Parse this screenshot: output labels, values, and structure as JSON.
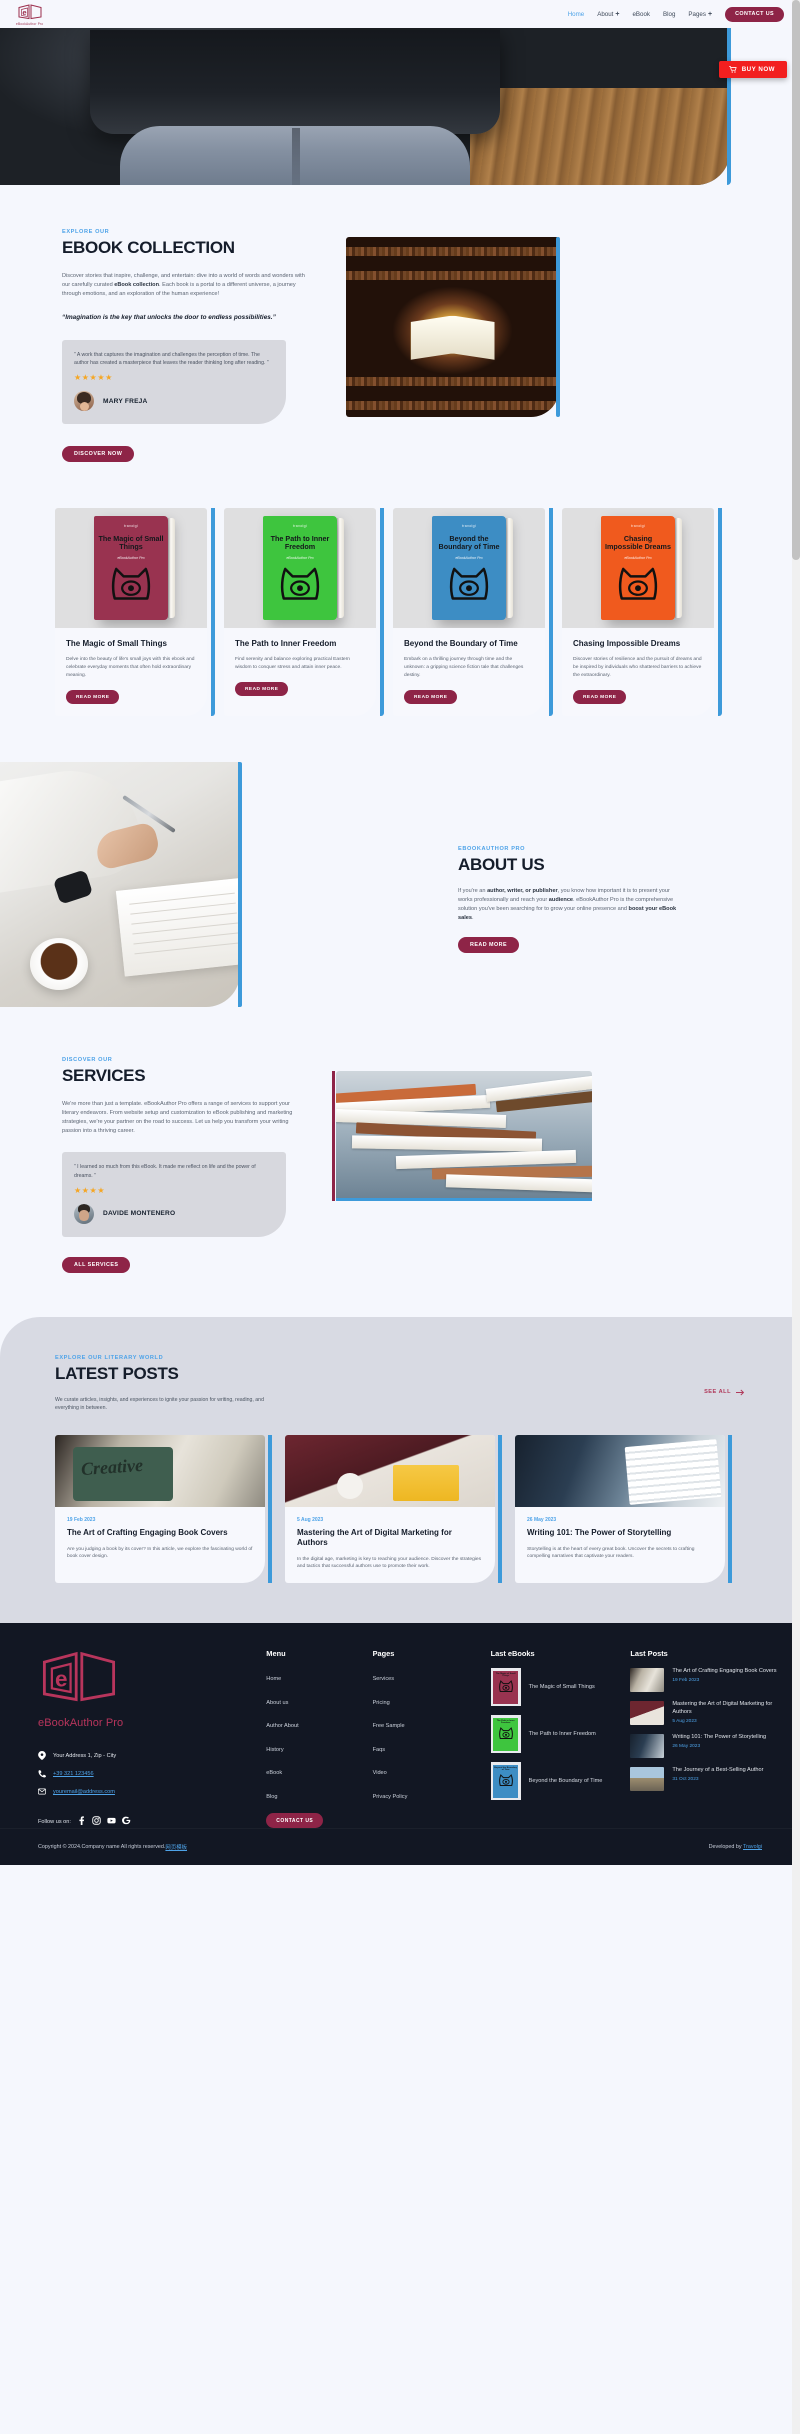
{
  "brand": {
    "name": "eBookAuthor Pro",
    "logo_icon": "open-book-e-logo"
  },
  "nav": {
    "items": [
      {
        "label": "Home",
        "active": true,
        "caret": false
      },
      {
        "label": "About",
        "active": false,
        "caret": true
      },
      {
        "label": "eBook",
        "active": false,
        "caret": false
      },
      {
        "label": "Blog",
        "active": false,
        "caret": false
      },
      {
        "label": "Pages",
        "active": false,
        "caret": true
      }
    ],
    "cta": "CONTACT US"
  },
  "hero": {
    "buy_label": "BUY NOW",
    "cart_icon": "shopping-cart-icon"
  },
  "collection": {
    "eyebrow": "EXPLORE OUR",
    "title": "EBOOK COLLECTION",
    "paragraph_1": "Discover stories that inspire, challenge, and entertain: dive into a world of words and wonders with our carefully curated ",
    "paragraph_bold": "eBook collection",
    "paragraph_2": ". Each book is a portal to a different universe, a journey through emotions, and an exploration of the human experience!",
    "quote": "“Imagination is the key that unlocks the door to endless possibilities.”",
    "testimonial": {
      "text": "” A work that captures the imagination and challenges the perception of time. The author has created a masterpiece that leaves the reader thinking long after reading. ”",
      "stars": "★★★★★",
      "name": "MARY FREJA"
    },
    "button": "DISCOVER NOW"
  },
  "books": [
    {
      "cover_title": "The Magic of Small Things",
      "cover_sub": "eBookAuthor Pro",
      "cover_logo": "travolgi",
      "color": "#993350",
      "title": "The Magic of Small Things",
      "desc": "Delve into the beauty of life's small joys with this ebook and celebrate everyday moments that often hold extraordinary meaning.",
      "button": "READ MORE"
    },
    {
      "cover_title": "The Path to Inner Freedom",
      "cover_sub": "eBookAuthor Pro",
      "cover_logo": "travolgi",
      "color": "#3ec53e",
      "title": "The Path to Inner Freedom",
      "desc": "Find serenity and balance exploring practical Eastern wisdom to conquer stress and attain inner peace.",
      "button": "READ MORE"
    },
    {
      "cover_title": "Beyond the Boundary of Time",
      "cover_sub": "eBookAuthor Pro",
      "cover_logo": "travolgi",
      "color": "#3d8dc4",
      "title": "Beyond the Boundary of Time",
      "desc": "Embark on a thrilling journey through time and the unknown: a gripping science fiction tale that challenges destiny.",
      "button": "READ MORE"
    },
    {
      "cover_title": "Chasing Impossible Dreams",
      "cover_sub": "eBookAuthor Pro",
      "cover_logo": "travolgi",
      "color": "#f05a1e",
      "title": "Chasing Impossible Dreams",
      "desc": "Discover stories of resilience and the pursuit of dreams and be inspired by individuals who shattered barriers to achieve the extraordinary.",
      "button": "READ MORE"
    }
  ],
  "about": {
    "eyebrow": "EBOOKAUTHOR PRO",
    "title": "ABOUT US",
    "p1": "If you're an ",
    "b1": "author, writer, or publisher",
    "p2": ", you know how important it is to present your works professionally and reach your ",
    "b2": "audience",
    "p3": ". eBookAuthor Pro is the comprehensive solution you've been searching for to grow your online presence and ",
    "b3": "boost your eBook sales",
    "p4": ".",
    "button": "READ MORE"
  },
  "services": {
    "eyebrow": "DISCOVER OUR",
    "title": "SERVICES",
    "paragraph": "We're more than just a template. eBookAuthor Pro offers a range of services to support your literary endeavors. From website setup and customization to eBook publishing and marketing strategies, we're your partner on the road to success. Let us help you transform your writing passion into a thriving career.",
    "testimonial": {
      "text": "” I learned so much from this eBook. It made me reflect on life and the power of dreams. ”",
      "stars": "★★★★",
      "name": "DAVIDE MONTENERO"
    },
    "button": "ALL SERVICES"
  },
  "posts_section": {
    "eyebrow": "EXPLORE OUR LITERARY WORLD",
    "title": "LATEST POSTS",
    "paragraph": "We curate articles, insights, and experiences to ignite your passion for writing, reading, and everything in between.",
    "see_all": "SEE ALL"
  },
  "posts": [
    {
      "date": "19 Feb 2023",
      "title": "The Art of Crafting Engaging Book Covers",
      "desc": "Are you judging a book by its cover? In this article, we explore the fascinating world of book cover design."
    },
    {
      "date": "5 Aug 2023",
      "title": "Mastering the Art of Digital Marketing for Authors",
      "desc": "In the digital age, marketing is key to reaching your audience. Discover the strategies and tactics that successful authors use to promote their work."
    },
    {
      "date": "26 May 2023",
      "title": "Writing 101: The Power of Storytelling",
      "desc": "Storytelling is at the heart of every great book. Uncover the secrets to crafting compelling narratives that captivate your readers."
    }
  ],
  "footer": {
    "address": "Your Address 1, Zip - City",
    "phone": "+39 321 123456",
    "email": "youremail@address.com",
    "follow_label": "Follow us on:",
    "socials": [
      "facebook-icon",
      "instagram-icon",
      "youtube-icon",
      "google-icon"
    ],
    "menu": {
      "heading": "Menu",
      "items": [
        "Home",
        "About us",
        "Author About",
        "History",
        "eBook",
        "Blog"
      ],
      "cta": "CONTACT US"
    },
    "pages": {
      "heading": "Pages",
      "items": [
        "Services",
        "Pricing",
        "Free Sample",
        "Faqs",
        "Video",
        "Privacy Policy"
      ]
    },
    "last_ebooks": {
      "heading": "Last eBooks",
      "items": [
        {
          "title": "The Magic of Small Things",
          "color": "#993350"
        },
        {
          "title": "The Path to Inner Freedom",
          "color": "#3ec53e"
        },
        {
          "title": "Beyond the Boundary of Time",
          "color": "#3d8dc4"
        }
      ]
    },
    "last_posts": {
      "heading": "Last Posts",
      "items": [
        {
          "title": "The Art of Crafting Engaging Book Covers",
          "date": "19 Feb 2023"
        },
        {
          "title": "Mastering the Art of Digital Marketing for Authors",
          "date": "5 Aug 2023"
        },
        {
          "title": "Writing 101: The Power of Storytelling",
          "date": "26 May 2023"
        },
        {
          "title": "The Journey of a Best-Selling Author",
          "date": "31 Oct 2023"
        }
      ]
    },
    "copyright": "Copyright © 2024.Company name All rights reserved.",
    "copyright_link": "网页模板",
    "developed_by": "Developed by",
    "developer": "Travolgi"
  },
  "colors": {
    "accent_blue": "#4ea3e8",
    "maroon": "#8e2447",
    "red": "#f21f1f",
    "dark": "#121723",
    "page_bg": "#f5f7fd"
  }
}
